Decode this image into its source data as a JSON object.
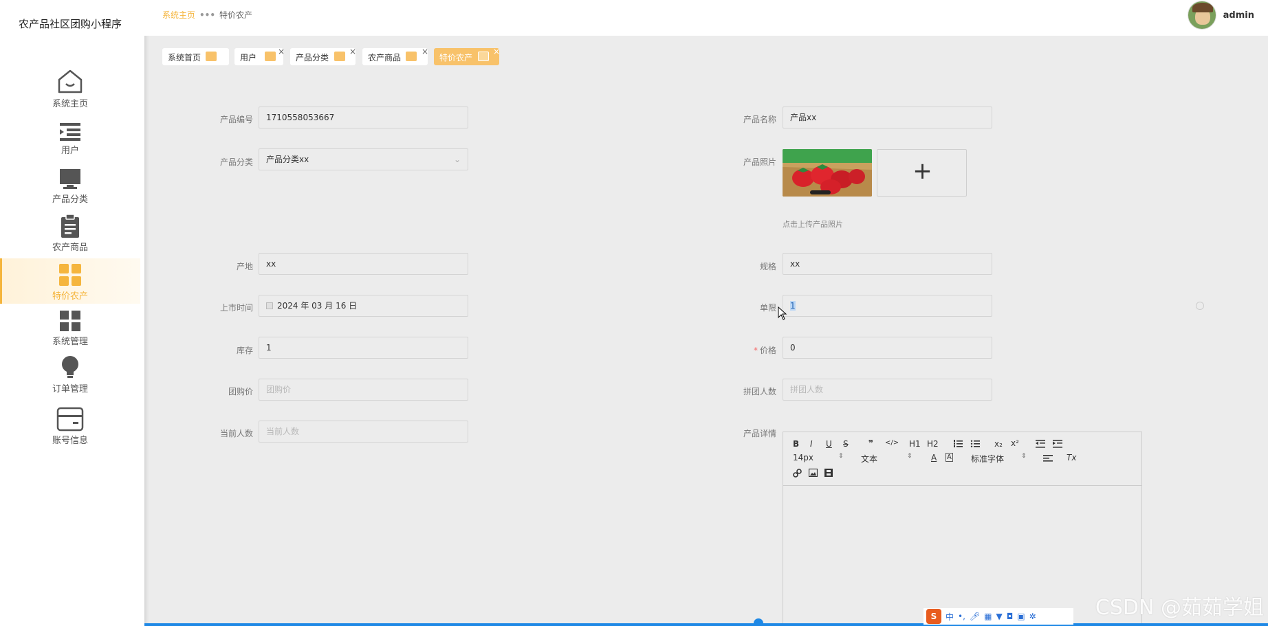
{
  "app": {
    "title": "农产品社区团购小程序"
  },
  "sidebar": {
    "items": [
      {
        "label": "系统主页",
        "icon": "home-icon"
      },
      {
        "label": "用户",
        "icon": "list-indent-icon"
      },
      {
        "label": "产品分类",
        "icon": "monitor-icon"
      },
      {
        "label": "农产商品",
        "icon": "clipboard-icon"
      },
      {
        "label": "特价农产",
        "icon": "grid-icon",
        "active": true
      },
      {
        "label": "系统管理",
        "icon": "grid-icon"
      },
      {
        "label": "订单管理",
        "icon": "lightbulb-icon"
      },
      {
        "label": "账号信息",
        "icon": "card-icon"
      }
    ]
  },
  "breadcrumb": {
    "home": "系统主页",
    "current": "特价农产"
  },
  "user": {
    "name": "admin"
  },
  "tabs": [
    {
      "label": "系统首页"
    },
    {
      "label": "用户"
    },
    {
      "label": "产品分类"
    },
    {
      "label": "农产商品"
    },
    {
      "label": "特价农产",
      "active": true
    }
  ],
  "form": {
    "product_no": {
      "label": "产品编号",
      "value": "1710558053667"
    },
    "product_name": {
      "label": "产品名称",
      "value": "产品xx"
    },
    "category": {
      "label": "产品分类",
      "value": "产品分类xx"
    },
    "photo": {
      "label": "产品照片",
      "hint": "点击上传产品照片",
      "add_symbol": "+"
    },
    "origin": {
      "label": "产地",
      "value": "xx"
    },
    "spec": {
      "label": "规格",
      "value": "xx"
    },
    "launch_date": {
      "label": "上市时间",
      "value": "2024 年 03 月 16 日"
    },
    "limit": {
      "label": "单限",
      "value": "1"
    },
    "stock": {
      "label": "库存",
      "value": "1"
    },
    "price": {
      "label": "价格",
      "required_mark": "*",
      "value": "0"
    },
    "group_price": {
      "label": "团购价",
      "placeholder": "团购价"
    },
    "group_people": {
      "label": "拼团人数",
      "placeholder": "拼团人数"
    },
    "current_people": {
      "label": "当前人数",
      "placeholder": "当前人数"
    },
    "detail": {
      "label": "产品详情"
    }
  },
  "editor": {
    "font_size": "14px",
    "text_style": "文本",
    "font_family": "标准字体",
    "buttons": [
      "B",
      "I",
      "U",
      "S",
      "❞",
      "</>",
      "H1",
      "H2",
      "x₂",
      "x²",
      "Tx"
    ]
  },
  "watermark": "CSDN @茹茹学姐",
  "ime": {
    "brand": "S",
    "lang": "中"
  }
}
